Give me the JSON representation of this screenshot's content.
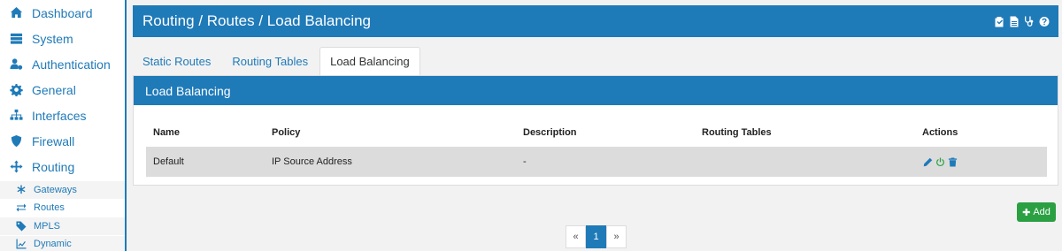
{
  "sidebar": {
    "items": [
      {
        "label": "Dashboard",
        "icon": "home-icon"
      },
      {
        "label": "System",
        "icon": "server-icon"
      },
      {
        "label": "Authentication",
        "icon": "users-cog-icon"
      },
      {
        "label": "General",
        "icon": "gear-icon"
      },
      {
        "label": "Interfaces",
        "icon": "sitemap-icon"
      },
      {
        "label": "Firewall",
        "icon": "shield-icon"
      },
      {
        "label": "Routing",
        "icon": "arrows-icon"
      }
    ],
    "sub_items": [
      {
        "label": "Gateways",
        "icon": "asterisk-icon"
      },
      {
        "label": "Routes",
        "icon": "exchange-icon"
      },
      {
        "label": "MPLS",
        "icon": "tag-icon"
      },
      {
        "label": "Dynamic",
        "icon": "chart-line-icon"
      }
    ]
  },
  "header": {
    "title": "Routing / Routes / Load Balancing",
    "icons": [
      "clipboard-check-icon",
      "file-icon",
      "stethoscope-icon",
      "question-circle-icon"
    ]
  },
  "tabs": [
    {
      "label": "Static Routes"
    },
    {
      "label": "Routing Tables"
    },
    {
      "label": "Load Balancing",
      "active": true
    }
  ],
  "panel": {
    "title": "Load Balancing",
    "columns": [
      "Name",
      "Policy",
      "Description",
      "Routing Tables",
      "Actions"
    ],
    "rows": [
      {
        "name": "Default",
        "policy": "IP Source Address",
        "description": "-",
        "routing_tables": ""
      }
    ]
  },
  "add_button": {
    "label": "Add"
  },
  "pagination": {
    "prev": "«",
    "current": "1",
    "next": "»"
  },
  "colors": {
    "primary": "#1f7ab8",
    "success": "#2ba043",
    "danger": "#1f7ab8"
  }
}
